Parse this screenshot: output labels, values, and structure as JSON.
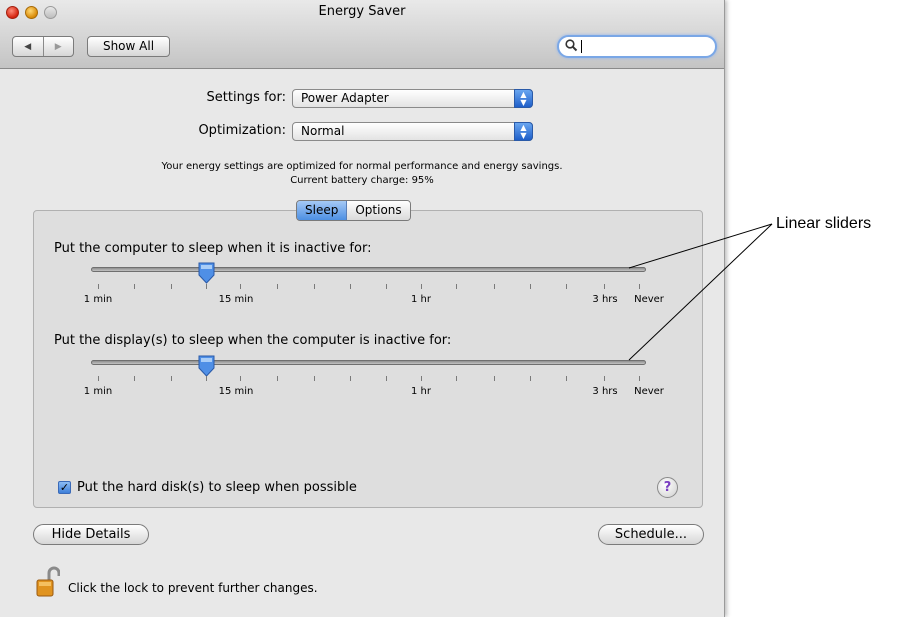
{
  "window": {
    "title": "Energy Saver",
    "show_all": "Show All",
    "search": {
      "placeholder": "",
      "value": ""
    }
  },
  "settings": {
    "settings_for_label": "Settings for:",
    "settings_for_value": "Power Adapter",
    "optimization_label": "Optimization:",
    "optimization_value": "Normal",
    "info_line1": "Your energy settings are optimized for normal performance and energy savings.",
    "info_line2": "Current battery charge: 95%"
  },
  "tabs": [
    {
      "label": "Sleep",
      "selected": true
    },
    {
      "label": "Options",
      "selected": false
    }
  ],
  "sliders": {
    "computer_label": "Put the computer to sleep when it is inactive for:",
    "display_label": "Put the display(s) to sleep when the computer is inactive for:",
    "tick_labels": {
      "min1": "1 min",
      "min15": "15 min",
      "hr1": "1 hr",
      "hrs3": "3 hrs",
      "never": "Never"
    },
    "computer_value": "15 min",
    "display_value": "15 min"
  },
  "harddisk": {
    "label": "Put the hard disk(s) to sleep when possible",
    "checked": true,
    "checkmark": "✓"
  },
  "help": {
    "label": "?"
  },
  "buttons": {
    "hide_details": "Hide Details",
    "schedule": "Schedule..."
  },
  "lock": {
    "text": "Click the lock to prevent further changes."
  },
  "annotation": {
    "text": "Linear sliders"
  },
  "icons": [
    "back-arrow-icon",
    "forward-arrow-icon",
    "search-icon",
    "popup-arrows-icon",
    "slider-thumb-icon",
    "checkbox-check-icon",
    "help-icon",
    "lock-open-icon"
  ],
  "colors": {
    "accent": "#3d7fd9",
    "help_glyph": "#7a3fc1"
  }
}
